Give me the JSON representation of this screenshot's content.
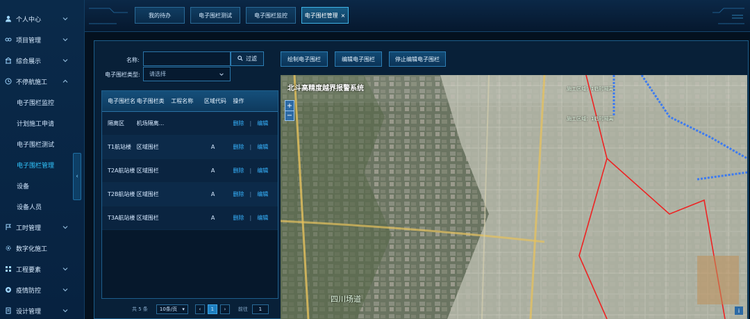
{
  "sidebar": {
    "items": [
      {
        "label": "个人中心",
        "icon": "user-icon"
      },
      {
        "label": "项目管理",
        "icon": "link-icon"
      },
      {
        "label": "综合展示",
        "icon": "building-icon"
      },
      {
        "label": "不停航施工",
        "icon": "clock-icon"
      }
    ],
    "sub_items": [
      "电子围栏监控",
      "计划施工申请",
      "电子围栏测试",
      "电子围栏管理",
      "设备",
      "设备人员"
    ],
    "active_sub": "电子围栏管理",
    "bottom_items": [
      {
        "label": "工时管理",
        "icon": "flag-icon"
      },
      {
        "label": "数字化施工",
        "icon": "gear-icon"
      },
      {
        "label": "工程要素",
        "icon": "grid-icon"
      },
      {
        "label": "疫情防控",
        "icon": "shield-icon"
      },
      {
        "label": "设计管理",
        "icon": "doc-icon"
      }
    ]
  },
  "tabs": [
    {
      "label": "我的待办"
    },
    {
      "label": "电子围栏测试"
    },
    {
      "label": "电子围栏监控"
    },
    {
      "label": "电子围栏管理",
      "active": true
    }
  ],
  "filters": {
    "name_label": "名称:",
    "name_value": "",
    "filter_button": "过滤",
    "type_label": "电子围栏类型:",
    "type_placeholder": "请选择"
  },
  "actions": {
    "draw": "绘制电子围栏",
    "edit": "编辑电子围栏",
    "stop": "停止编辑电子围栏"
  },
  "table": {
    "headers": [
      "电子围栏名",
      "电子围栏类",
      "工程名称",
      "区域代码",
      "操作"
    ],
    "rows": [
      {
        "name": "隔离区",
        "type": "机场隔离...",
        "project": "",
        "code": "",
        "delete": "删除",
        "edit": "编辑"
      },
      {
        "name": "T1航站楼",
        "type": "区域围栏",
        "project": "",
        "code": "A",
        "delete": "删除",
        "edit": "编辑"
      },
      {
        "name": "T2A航站楼",
        "type": "区域围栏",
        "project": "",
        "code": "A",
        "delete": "删除",
        "edit": "编辑"
      },
      {
        "name": "T2B航站楼",
        "type": "区域围栏",
        "project": "",
        "code": "A",
        "delete": "删除",
        "edit": "编辑"
      },
      {
        "name": "T3A航站楼",
        "type": "区域围栏",
        "project": "",
        "code": "A",
        "delete": "删除",
        "edit": "编辑"
      }
    ],
    "op_separator": "|"
  },
  "pagination": {
    "total": "共 5 条",
    "page_size": "10条/页",
    "current": "1",
    "goto_label": "前往",
    "goto_value": "1",
    "prev": "‹",
    "next": "›"
  },
  "map": {
    "title": "北斗高精度越界报警系统",
    "zoom_in": "+",
    "zoom_out": "−",
    "info": "i",
    "labels": [
      "四川场道",
      "施工区域：1临时隔离",
      "施工区域：1临时隔离"
    ]
  }
}
